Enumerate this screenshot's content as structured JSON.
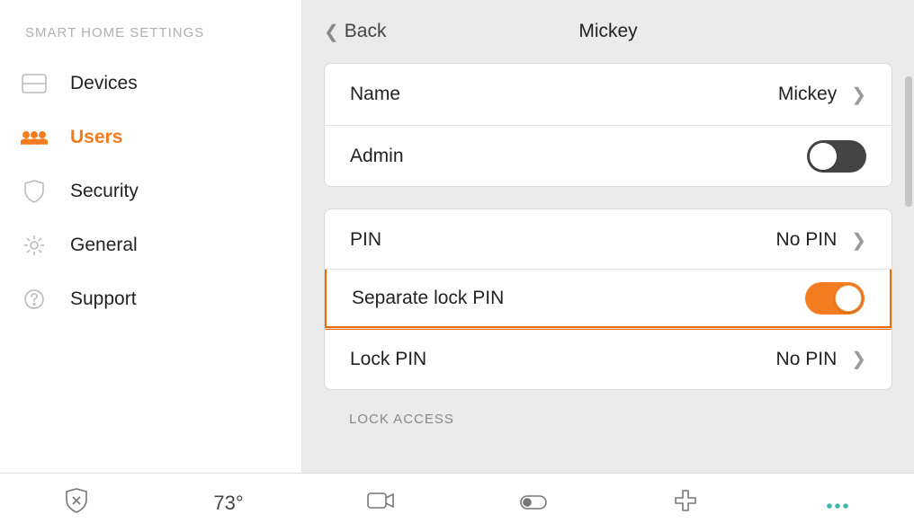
{
  "sidebar": {
    "title": "SMART HOME SETTINGS",
    "items": [
      {
        "label": "Devices"
      },
      {
        "label": "Users"
      },
      {
        "label": "Security"
      },
      {
        "label": "General"
      },
      {
        "label": "Support"
      }
    ],
    "active_index": 1
  },
  "header": {
    "back_label": "Back",
    "title": "Mickey"
  },
  "groups": [
    {
      "rows": [
        {
          "label": "Name",
          "value": "Mickey",
          "chevron": true
        },
        {
          "label": "Admin",
          "toggle": "off"
        }
      ]
    },
    {
      "rows": [
        {
          "label": "PIN",
          "value": "No PIN",
          "chevron": true
        },
        {
          "label": "Separate lock PIN",
          "toggle": "on",
          "highlight": true
        },
        {
          "label": "Lock PIN",
          "value": "No PIN",
          "chevron": true
        }
      ]
    }
  ],
  "section_label": "LOCK ACCESS",
  "bottombar": {
    "temperature": "73°"
  }
}
